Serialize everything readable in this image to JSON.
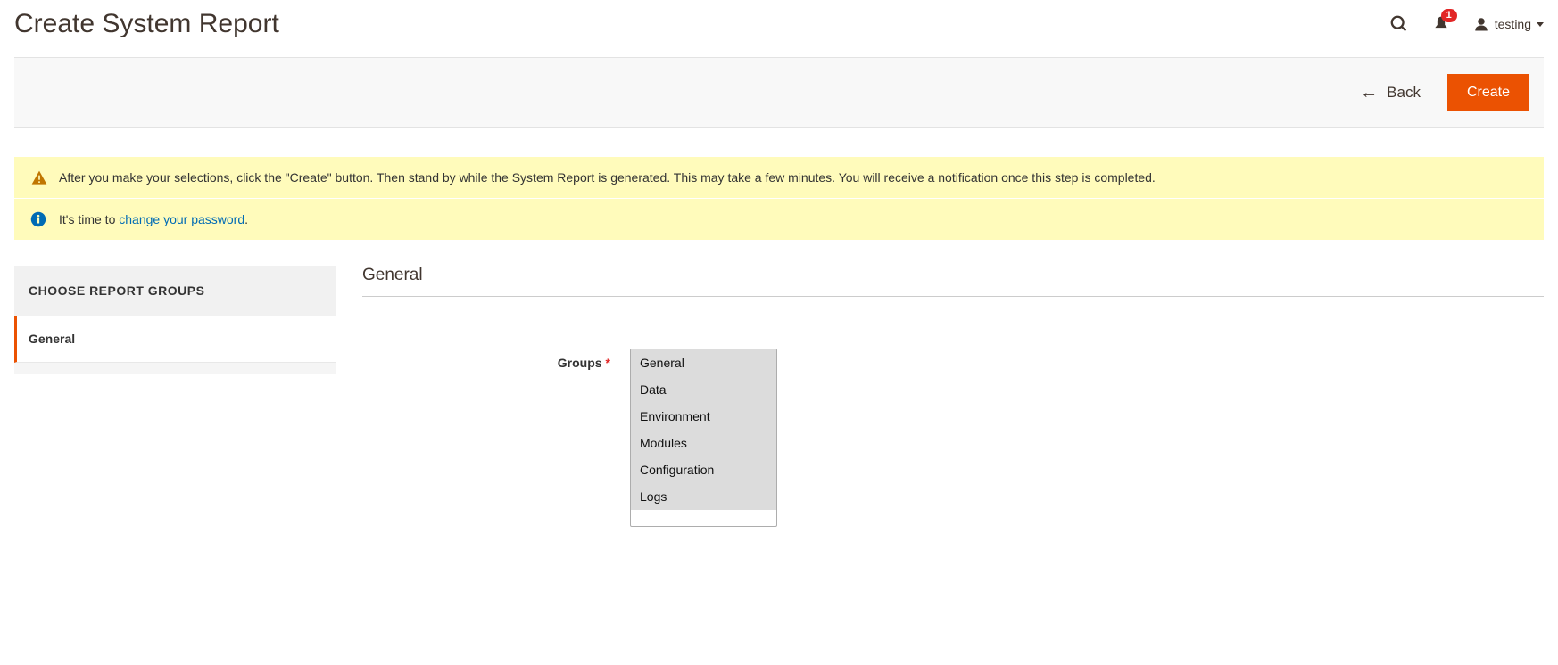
{
  "header": {
    "title": "Create System Report",
    "notification_count": "1",
    "user_name": "testing"
  },
  "actions": {
    "back_label": "Back",
    "create_label": "Create"
  },
  "messages": {
    "warning_text": "After you make your selections, click the \"Create\" button. Then stand by while the System Report is generated. This may take a few minutes. You will receive a notification once this step is completed.",
    "info_prefix": "It's time to ",
    "info_link": "change your password",
    "info_suffix": "."
  },
  "sidebar": {
    "header": "CHOOSE REPORT GROUPS",
    "items": [
      {
        "label": "General"
      }
    ]
  },
  "section": {
    "title": "General"
  },
  "form": {
    "groups_label": "Groups",
    "groups_options": [
      "General",
      "Data",
      "Environment",
      "Modules",
      "Configuration",
      "Logs"
    ]
  }
}
